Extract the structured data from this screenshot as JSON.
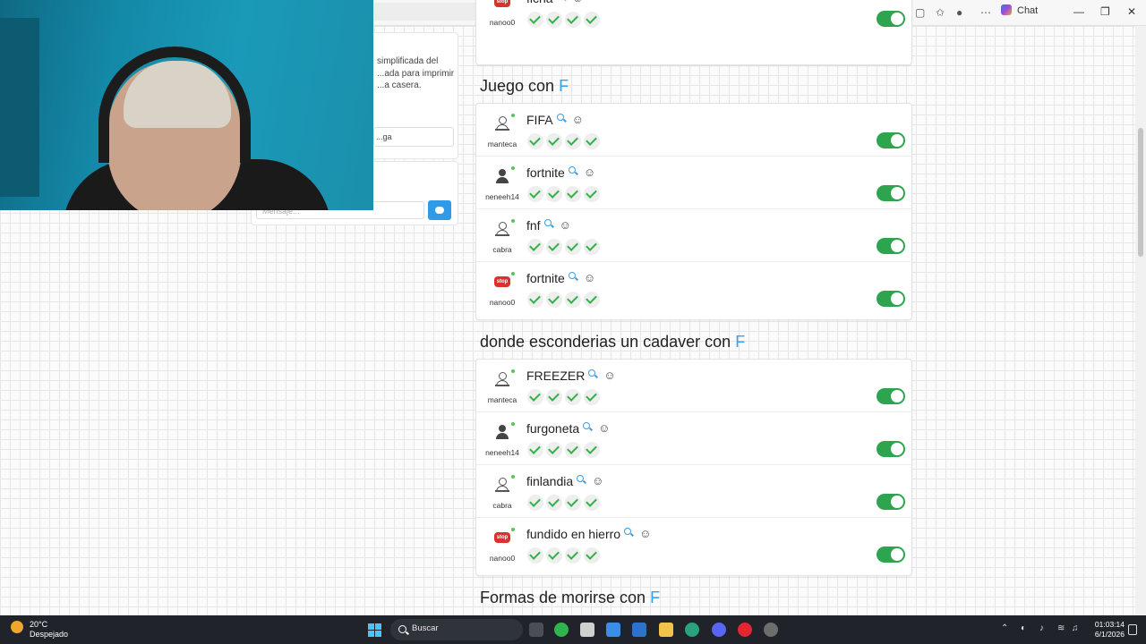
{
  "browser": {
    "chat_label": "Chat"
  },
  "side_panel": {
    "description": "simplificada del ...ada para imprimir ...a casera.",
    "input_text": "...ga",
    "chat_placeholder": "Mensaje..."
  },
  "sections": [
    {
      "title": "",
      "letter": "",
      "entries": [
        {
          "answer": "ficha",
          "user": "nanoo0",
          "avatar": "stop",
          "checks": 4,
          "enabled": true
        }
      ]
    },
    {
      "title": "Juego con",
      "letter": "F",
      "entries": [
        {
          "answer": "FIFA",
          "user": "manteca",
          "avatar": "person",
          "checks": 4,
          "enabled": true
        },
        {
          "answer": "fortnite",
          "user": "neneeh14",
          "avatar": "dark",
          "checks": 4,
          "enabled": true
        },
        {
          "answer": "fnf",
          "user": "cabra",
          "avatar": "person",
          "checks": 4,
          "enabled": true
        },
        {
          "answer": "fortnite",
          "user": "nanoo0",
          "avatar": "stop",
          "checks": 4,
          "enabled": true
        }
      ]
    },
    {
      "title": "donde esconderias un cadaver con",
      "letter": "F",
      "entries": [
        {
          "answer": "FREEZER",
          "user": "manteca",
          "avatar": "person",
          "checks": 4,
          "enabled": true
        },
        {
          "answer": "furgoneta",
          "user": "neneeh14",
          "avatar": "dark",
          "checks": 4,
          "enabled": true
        },
        {
          "answer": "finlandia",
          "user": "cabra",
          "avatar": "person",
          "checks": 4,
          "enabled": true
        },
        {
          "answer": "fundido en hierro",
          "user": "nanoo0",
          "avatar": "stop",
          "checks": 4,
          "enabled": true
        }
      ]
    },
    {
      "title": "Formas de morirse con",
      "letter": "F",
      "entries": []
    }
  ],
  "avatar_stop_label": "stop",
  "taskbar": {
    "temperature": "20°C",
    "weather": "Despejado",
    "search_label": "Buscar",
    "time": "01:03:14",
    "date": "6/1/2026"
  },
  "colors": {
    "accent_letter": "#3aa0e8",
    "check_green": "#33b249",
    "toggle_green": "#2ea44f",
    "stop_red": "#d9312c"
  },
  "icons": [
    "search-icon",
    "face-icon",
    "check-icon",
    "toggle",
    "person-icon",
    "stop-icon",
    "windows-start-icon"
  ]
}
